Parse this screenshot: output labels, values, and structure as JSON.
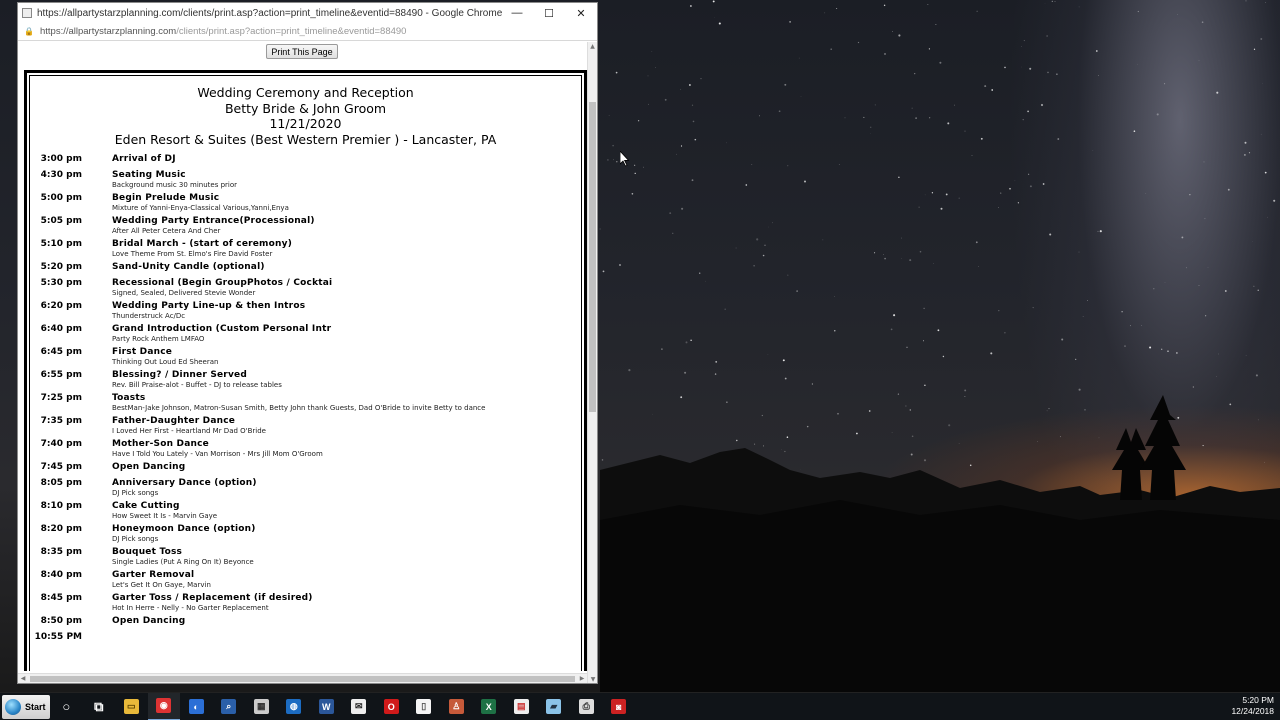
{
  "browser": {
    "title": "https://allpartystarzplanning.com/clients/print.asp?action=print_timeline&eventid=88490 - Google Chrome",
    "url_host": "https://allpartystarzplanning.com",
    "url_path": "/clients/print.asp?action=print_timeline&eventid=88490",
    "controls": {
      "minimize": "—",
      "maximize": "☐",
      "close": "✕"
    }
  },
  "page": {
    "print_button": "Print This Page",
    "header": {
      "event_name": "Wedding Ceremony and Reception",
      "couple": "Betty Bride & John Groom",
      "date": "11/21/2020",
      "venue": "Eden Resort & Suites (Best Western Premier ) - Lancaster, PA"
    },
    "timeline": [
      {
        "time": "3:00 pm",
        "title": "Arrival of DJ",
        "subtitle": ""
      },
      {
        "time": "4:30 pm",
        "title": "Seating Music",
        "subtitle": "Background music 30 minutes prior"
      },
      {
        "time": "5:00 pm",
        "title": "Begin Prelude Music",
        "subtitle": "Mixture of Yanni-Enya-Classical Various,Yanni,Enya"
      },
      {
        "time": "5:05 pm",
        "title": "Wedding Party Entrance(Processional)",
        "subtitle": "After All Peter Cetera And Cher"
      },
      {
        "time": "5:10 pm",
        "title": "Bridal March - (start of ceremony)",
        "subtitle": "Love Theme From St. Elmo's Fire David Foster"
      },
      {
        "time": "5:20 pm",
        "title": "Sand-Unity Candle (optional)",
        "subtitle": ""
      },
      {
        "time": "5:30 pm",
        "title": "Recessional (Begin GroupPhotos / Cocktai",
        "subtitle": "Signed, Sealed, Delivered Stevie Wonder"
      },
      {
        "time": "6:20 pm",
        "title": "Wedding Party Line-up & then Intros",
        "subtitle": "Thunderstruck Ac/Dc"
      },
      {
        "time": "6:40 pm",
        "title": "Grand Introduction (Custom Personal Intr",
        "subtitle": "Party Rock Anthem LMFAO"
      },
      {
        "time": "6:45 pm",
        "title": "First Dance",
        "subtitle": "Thinking Out Loud Ed Sheeran"
      },
      {
        "time": "6:55 pm",
        "title": "Blessing? / Dinner Served",
        "subtitle": "Rev. Bill Praise-alot - Buffet - DJ to release tables"
      },
      {
        "time": "7:25 pm",
        "title": "Toasts",
        "subtitle": "BestMan-Jake Johnson, Matron-Susan Smith, Betty John thank Guests, Dad O'Bride to invite Betty to dance"
      },
      {
        "time": "7:35 pm",
        "title": "Father-Daughter Dance",
        "subtitle": "I Loved Her First - Heartland Mr Dad O'Bride"
      },
      {
        "time": "7:40 pm",
        "title": "Mother-Son Dance",
        "subtitle": "Have I Told You Lately - Van Morrison - Mrs Jill Mom O'Groom"
      },
      {
        "time": "7:45 pm",
        "title": "Open Dancing",
        "subtitle": ""
      },
      {
        "time": "8:05 pm",
        "title": "Anniversary Dance (option)",
        "subtitle": "DJ Pick songs"
      },
      {
        "time": "8:10 pm",
        "title": "Cake Cutting",
        "subtitle": "How Sweet It Is - Marvin Gaye"
      },
      {
        "time": "8:20 pm",
        "title": "Honeymoon Dance (option)",
        "subtitle": "DJ Pick songs"
      },
      {
        "time": "8:35 pm",
        "title": "Bouquet Toss",
        "subtitle": "Single Ladies (Put A Ring On It) Beyonce"
      },
      {
        "time": "8:40 pm",
        "title": "Garter Removal",
        "subtitle": "Let's Get It On Gaye, Marvin"
      },
      {
        "time": "8:45 pm",
        "title": "Garter Toss / Replacement (if desired)",
        "subtitle": "Hot In Herre - Nelly - No Garter Replacement"
      },
      {
        "time": "8:50 pm",
        "title": "Open Dancing",
        "subtitle": ""
      },
      {
        "time": "10:55 PM",
        "title": "",
        "subtitle": ""
      }
    ]
  },
  "taskbar": {
    "start_label": "Start",
    "apps": [
      "cortana-icon",
      "task-view-icon",
      "file-explorer-icon",
      "chrome-icon",
      "app-icon",
      "search-app-icon",
      "calculator-icon",
      "globe-icon",
      "word-icon",
      "mail-icon",
      "opera-icon",
      "notepad-icon",
      "user-app-icon",
      "excel-icon",
      "calendar-icon",
      "book-icon",
      "printer-icon",
      "recorder-icon"
    ],
    "clock_time": "5:20 PM",
    "clock_date": "12/24/2018"
  }
}
